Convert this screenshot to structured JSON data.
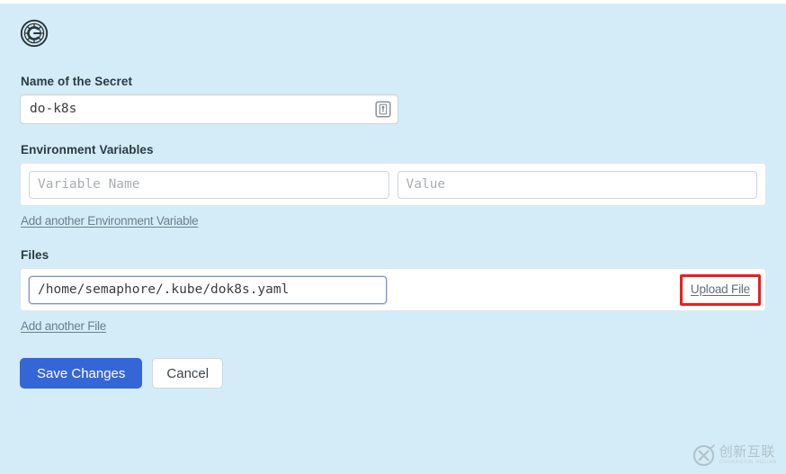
{
  "page": {
    "background_color": "#d3ecf8",
    "header_icon": "settings-gear-icon"
  },
  "form": {
    "secret_name": {
      "label": "Name of the Secret",
      "value": "do-k8s",
      "placeholder": "",
      "field_icon": "password-manager-icon"
    },
    "environment_variables": {
      "label": "Environment Variables",
      "rows": [
        {
          "name_value": "",
          "name_placeholder": "Variable Name",
          "value_value": "",
          "value_placeholder": "Value"
        }
      ],
      "add_link": "Add another Environment Variable"
    },
    "files": {
      "label": "Files",
      "rows": [
        {
          "path_value": "/home/semaphore/.kube/dok8s.yaml",
          "path_placeholder": "",
          "upload_label": "Upload File",
          "upload_highlighted": true,
          "highlight_color": "#ee1c1c"
        }
      ],
      "add_link": "Add another File"
    }
  },
  "actions": {
    "save_label": "Save Changes",
    "cancel_label": "Cancel",
    "primary_color": "#3566d6"
  },
  "watermark": {
    "icon": "circled-x-logo-icon",
    "text_cn": "创新互联",
    "text_en": "CHUANGXIN HULIAN"
  }
}
